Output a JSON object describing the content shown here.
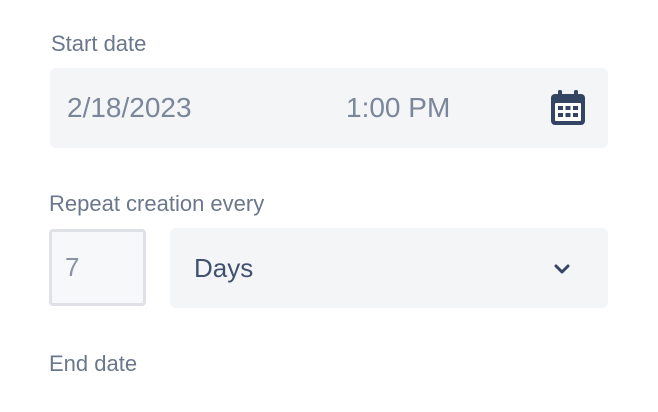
{
  "start_date": {
    "label": "Start date",
    "date_value": "2/18/2023",
    "time_value": "1:00 PM",
    "icon": "calendar-icon"
  },
  "repeat": {
    "label": "Repeat creation every",
    "interval_value": "7",
    "unit_value": "Days",
    "icon": "chevron-down-icon"
  },
  "end_date": {
    "label": "End date"
  },
  "colors": {
    "label_text": "#6b778c",
    "field_bg": "#f4f5f7",
    "value_text": "#7a869a",
    "select_text": "#42526e",
    "icon": "#344563"
  }
}
